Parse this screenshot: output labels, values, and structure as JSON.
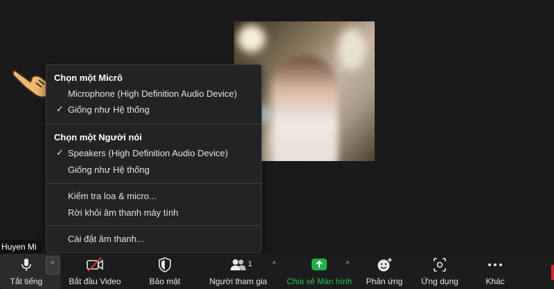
{
  "participant": {
    "name": "Huyen Mi"
  },
  "audio_menu": {
    "microphone_heading": "Chọn một Micrô",
    "microphone_options": [
      {
        "label": "Microphone (High Definition Audio Device)",
        "checked": false
      },
      {
        "label": "Giống như Hệ thống",
        "checked": true
      }
    ],
    "speaker_heading": "Chọn một Người nói",
    "speaker_options": [
      {
        "label": "Speakers (High Definition Audio Device)",
        "checked": true
      },
      {
        "label": "Giống như Hệ thống",
        "checked": false
      }
    ],
    "test_label": "Kiểm tra loa & micro...",
    "leave_audio_label": "Rời khỏi âm thanh máy tính",
    "settings_label": "Cài đặt âm thanh...",
    "check_glyph": "✓"
  },
  "toolbar": {
    "mute_label": "Tắt tiếng",
    "video_label": "Bắt đầu Video",
    "security_label": "Bảo mật",
    "participants_label": "Người tham gia",
    "participants_count": "1",
    "share_label": "Chia sẻ Màn hình",
    "reactions_label": "Phản ứng",
    "apps_label": "Ứng dụng",
    "more_label": "Khác",
    "caret_glyph": "^"
  },
  "colors": {
    "share_green": "#33c04f",
    "share_icon_bg": "#21b14a",
    "video_off_red": "#e03c3c"
  }
}
